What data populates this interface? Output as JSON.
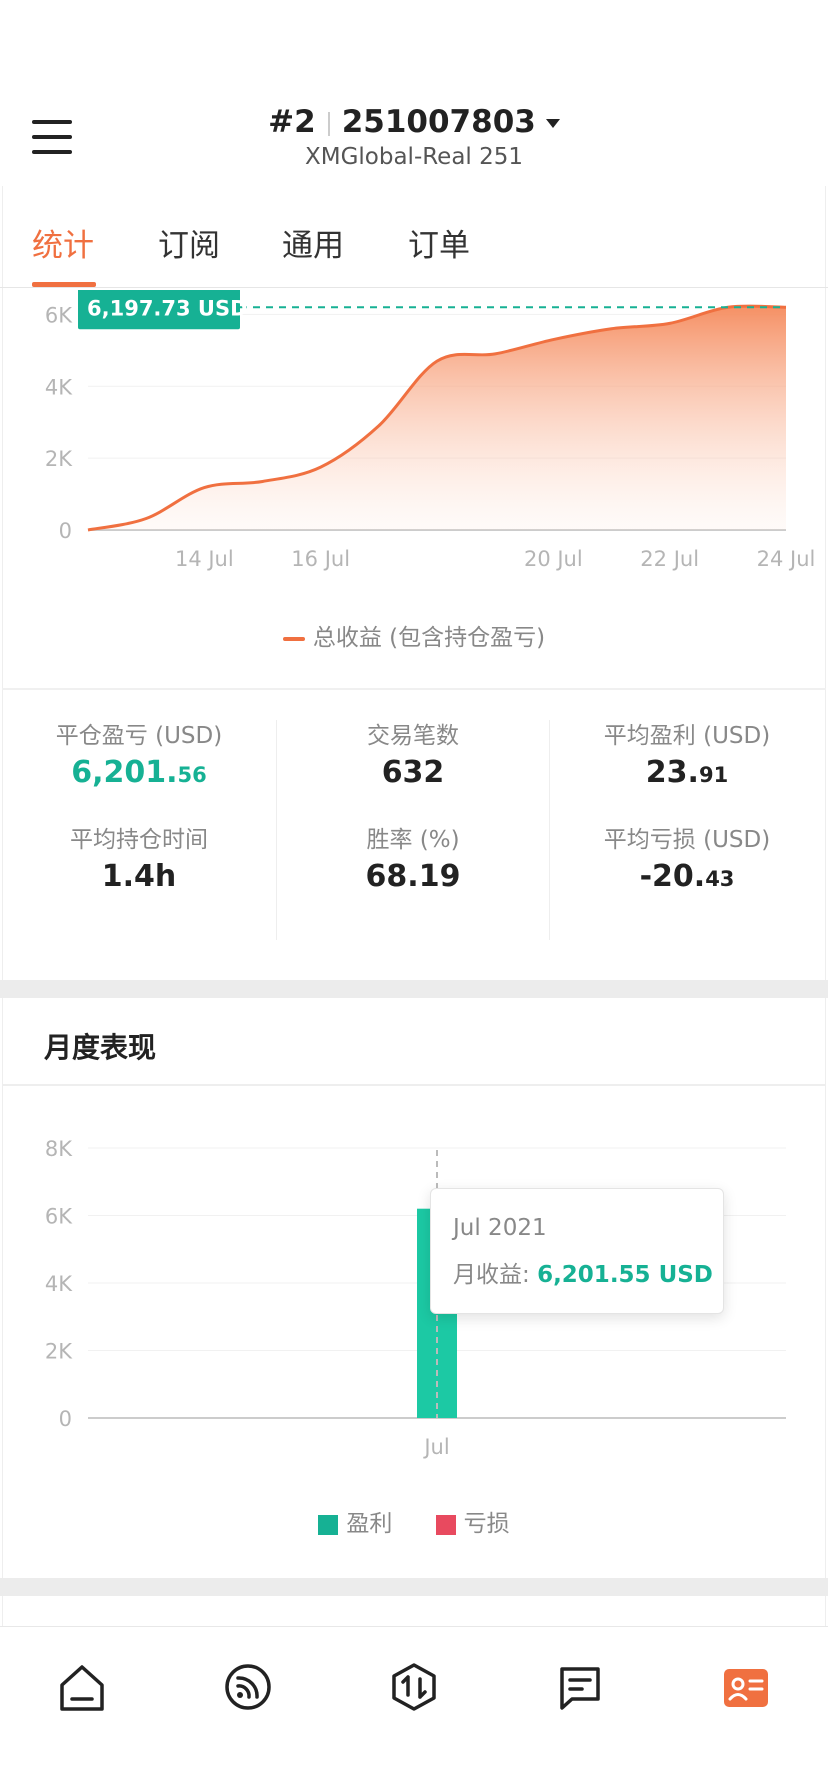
{
  "header": {
    "account_number_prefix": "#2",
    "account_id": "251007803",
    "server": "XMGlobal-Real 251"
  },
  "tabs": [
    {
      "label": "统计",
      "active": true
    },
    {
      "label": "订阅",
      "active": false
    },
    {
      "label": "通用",
      "active": false
    },
    {
      "label": "订单",
      "active": false
    }
  ],
  "equity_chart": {
    "badge": "6,197.73 USD",
    "legend": "总收益 (包含持仓盈亏)"
  },
  "stats": {
    "closed_pnl": {
      "label": "平仓盈亏 (USD)",
      "int": "6,201.",
      "dec": "56"
    },
    "avg_hold": {
      "label": "平均持仓时间",
      "value": "1.4h"
    },
    "trades": {
      "label": "交易笔数",
      "value": "632"
    },
    "win_rate": {
      "label": "胜率 (%)",
      "value": "68.19"
    },
    "avg_profit": {
      "label": "平均盈利 (USD)",
      "int": "23.",
      "dec": "91"
    },
    "avg_loss": {
      "label": "平均亏损 (USD)",
      "int": "-20.",
      "dec": "43"
    }
  },
  "monthly": {
    "title": "月度表现",
    "tooltip": {
      "date": "Jul 2021",
      "label": "月收益: ",
      "value": "6,201.55 USD"
    },
    "legend": {
      "profit": "盈利",
      "loss": "亏损"
    }
  },
  "colors": {
    "accent": "#f07040",
    "green": "#16b194",
    "bar": "#1cc9a4",
    "loss": "#e84a5f"
  },
  "chart_data": [
    {
      "type": "area",
      "x": [
        "12 Jul",
        "13 Jul",
        "14 Jul",
        "15 Jul",
        "16 Jul",
        "17 Jul",
        "18 Jul",
        "19 Jul",
        "20 Jul",
        "21 Jul",
        "22 Jul",
        "23 Jul",
        "24 Jul"
      ],
      "series": [
        {
          "name": "总收益 (包含持仓盈亏)",
          "values": [
            0,
            320,
            1180,
            1350,
            1750,
            2900,
            4700,
            4900,
            5300,
            5600,
            5750,
            6197.73,
            6197.73
          ]
        }
      ],
      "xticks": [
        "14 Jul",
        "16 Jul",
        "20 Jul",
        "22 Jul",
        "24 Jul"
      ],
      "yticks": [
        "0",
        "2K",
        "4K",
        "6K"
      ],
      "ylim": [
        0,
        6400
      ],
      "grid": true
    },
    {
      "type": "bar",
      "categories": [
        "Jul"
      ],
      "series": [
        {
          "name": "盈利",
          "values": [
            6201.55
          ]
        },
        {
          "name": "亏损",
          "values": [
            0
          ]
        }
      ],
      "yticks": [
        "0",
        "2K",
        "4K",
        "6K",
        "8K"
      ],
      "ylim": [
        0,
        8000
      ],
      "grid": true
    }
  ]
}
